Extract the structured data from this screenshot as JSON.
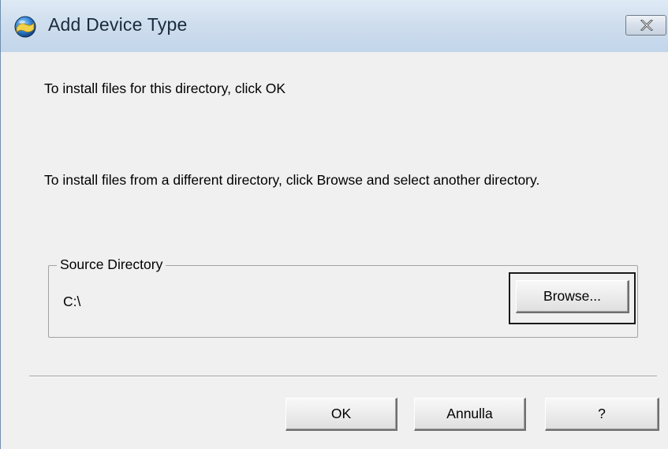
{
  "window": {
    "title": "Add Device Type",
    "app_icon": "setup-globe-icon",
    "close_icon": "close-x-icon"
  },
  "messages": {
    "line1": "To install files for this directory, click OK",
    "line2": "To install files from a different directory, click Browse and select another directory."
  },
  "source_directory": {
    "label": "Source Directory",
    "value": "C:\\",
    "browse_label": "Browse..."
  },
  "buttons": {
    "ok": "OK",
    "cancel": "Annulla",
    "help": "?"
  },
  "colors": {
    "titlebar": "#cfdeee",
    "client": "#f0f0f0"
  }
}
